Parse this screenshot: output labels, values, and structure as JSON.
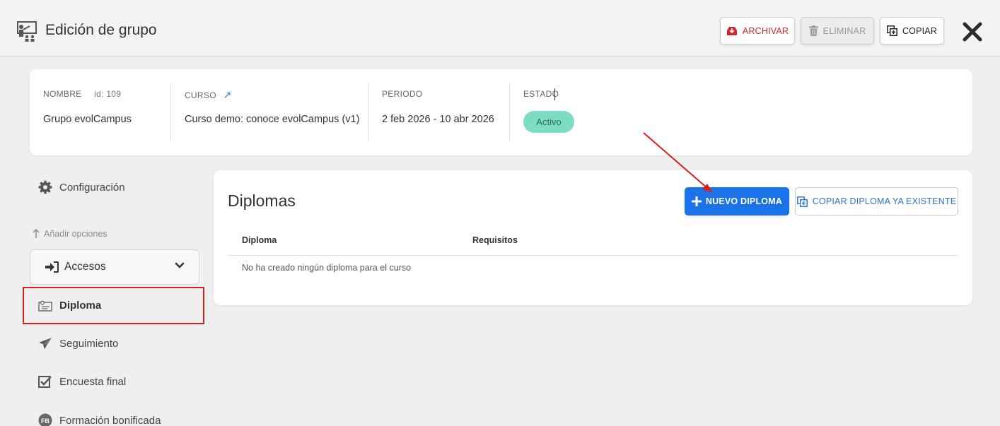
{
  "header": {
    "title": "Edición de grupo",
    "archive_label": "ARCHIVAR",
    "delete_label": "ELIMINAR",
    "copy_label": "COPIAR"
  },
  "info": {
    "name_label": "NOMBRE",
    "id_label": "id: 109",
    "name_value": "Grupo evolCampus",
    "course_label": "CURSO",
    "course_value": "Curso demo: conoce evolCampus (v1)",
    "period_label": "PERIODO",
    "period_value": "2 feb 2026 - 10 abr 2026",
    "status_label": "ESTADO",
    "status_value": "Activo"
  },
  "sidebar": {
    "config_label": "Configuración",
    "add_options_label": "Añadir opciones",
    "accesos_label": "Accesos",
    "items": [
      {
        "label": "Diploma"
      },
      {
        "label": "Seguimiento"
      },
      {
        "label": "Encuesta final"
      },
      {
        "label": "Formación bonificada"
      }
    ]
  },
  "main": {
    "title": "Diplomas",
    "new_button": "NUEVO DIPLOMA",
    "copy_button": "COPIAR DIPLOMA YA EXISTENTE",
    "columns": [
      "Diploma",
      "Requisitos"
    ],
    "empty_message": "No ha creado ningún diploma para el curso"
  },
  "colors": {
    "primary": "#1a73e8",
    "status_active": "#7fdcc4",
    "archive": "#d0272b",
    "annotation": "#d81e1e"
  }
}
